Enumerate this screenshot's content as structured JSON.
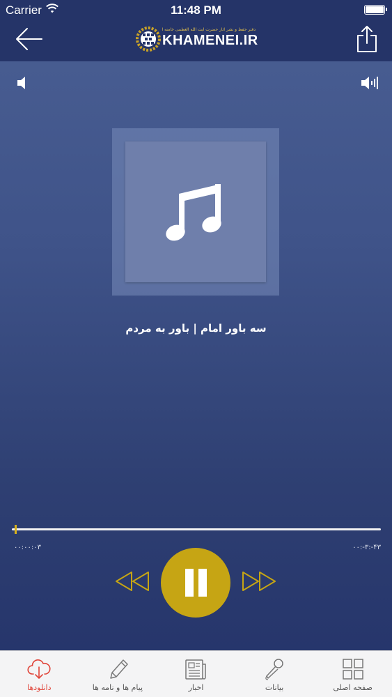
{
  "status_bar": {
    "carrier": "Carrier",
    "time": "11:48 PM",
    "icons": [
      "wifi-icon",
      "battery-icon"
    ]
  },
  "nav_bar": {
    "back_icon": "arrow-left-icon",
    "logo_tagline": "دفتر حفظ و نشر آثار حضرت آیت الله العظمی خامنه ای",
    "logo_text": "KHAMENEI.IR",
    "share_icon": "share-icon"
  },
  "player": {
    "volume_low_icon": "speaker-low-icon",
    "volume_high_icon": "speaker-high-icon",
    "artwork_icon": "music-note-icon",
    "track_title": "سه باور امام | باور به مردم",
    "progress_fraction": 0.01,
    "time_elapsed": "۰۰:۰۰:۰۳",
    "time_remaining": "۰۰:-۳:-۴۳",
    "rewind_icon": "rewind-icon",
    "pause_icon": "pause-icon",
    "forward_icon": "fast-forward-icon",
    "accent_color": "#c6a514"
  },
  "tabs": [
    {
      "label": "دانلودها",
      "icon": "cloud-download-icon",
      "active": true
    },
    {
      "label": "پیام ها و نامه ها",
      "icon": "pen-icon",
      "active": false
    },
    {
      "label": "اخبار",
      "icon": "newspaper-icon",
      "active": false
    },
    {
      "label": "بیانات",
      "icon": "microphone-icon",
      "active": false
    },
    {
      "label": "صفحه اصلی",
      "icon": "grid-icon",
      "active": false
    }
  ],
  "colors": {
    "active_tab": "#e0453a",
    "header_bg": "#253468",
    "background_top": "#4a5f93",
    "background_bottom": "#24336a"
  }
}
